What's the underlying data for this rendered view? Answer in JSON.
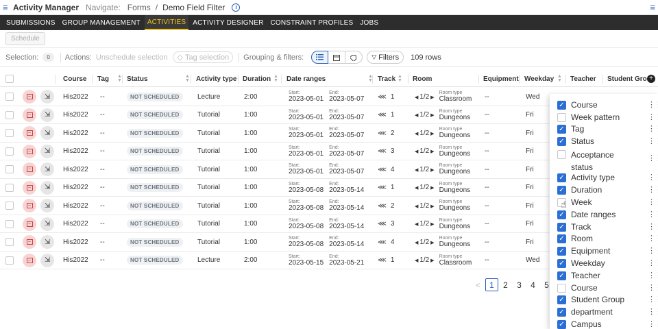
{
  "topbar": {
    "app_title": "Activity Manager",
    "navigate_label": "Navigate:",
    "crumb_1": "Forms",
    "crumb_sep": "/",
    "crumb_2": "Demo Field Filter",
    "info": "i"
  },
  "nav": {
    "tabs": [
      {
        "label": "SUBMISSIONS"
      },
      {
        "label": "GROUP MANAGEMENT"
      },
      {
        "label": "ACTIVITIES"
      },
      {
        "label": "ACTIVITY DESIGNER"
      },
      {
        "label": "CONSTRAINT PROFILES"
      },
      {
        "label": "JOBS"
      }
    ],
    "active_tab": "ACTIVITIES"
  },
  "schedule_button": "Schedule",
  "toolbar": {
    "selection_label": "Selection:",
    "selection_count": "0",
    "actions_label": "Actions:",
    "unschedule": "Unschedule selection",
    "tag_selection": "Tag selection",
    "grouping_label": "Grouping & filters:",
    "filters": "Filters",
    "rows_count": "109 rows"
  },
  "table": {
    "columns": {
      "course": "Course",
      "tag": "Tag",
      "status": "Status",
      "activity_type": "Activity type",
      "duration": "Duration",
      "date_ranges": "Date ranges",
      "track": "Track",
      "room": "Room",
      "equipment": "Equipment",
      "weekday": "Weekday",
      "teacher": "Teacher",
      "student_group": "Student Gro"
    },
    "start_label": "Start:",
    "end_label": "End:",
    "room_type_label": "Room type",
    "rows": [
      {
        "course": "His2022",
        "tag": "--",
        "status": "NOT SCHEDULED",
        "type": "Lecture",
        "duration": "2:00",
        "start": "2023-05-01",
        "end": "2023-05-07",
        "track": "1",
        "room_nav": "1/2",
        "room_type": "Classroom",
        "equipment": "--",
        "weekday": "Wed"
      },
      {
        "course": "His2022",
        "tag": "--",
        "status": "NOT SCHEDULED",
        "type": "Tutorial",
        "duration": "1:00",
        "start": "2023-05-01",
        "end": "2023-05-07",
        "track": "1",
        "room_nav": "1/2",
        "room_type": "Dungeons",
        "equipment": "--",
        "weekday": "Fri"
      },
      {
        "course": "His2022",
        "tag": "--",
        "status": "NOT SCHEDULED",
        "type": "Tutorial",
        "duration": "1:00",
        "start": "2023-05-01",
        "end": "2023-05-07",
        "track": "2",
        "room_nav": "1/2",
        "room_type": "Dungeons",
        "equipment": "--",
        "weekday": "Fri"
      },
      {
        "course": "His2022",
        "tag": "--",
        "status": "NOT SCHEDULED",
        "type": "Tutorial",
        "duration": "1:00",
        "start": "2023-05-01",
        "end": "2023-05-07",
        "track": "3",
        "room_nav": "1/2",
        "room_type": "Dungeons",
        "equipment": "--",
        "weekday": "Fri"
      },
      {
        "course": "His2022",
        "tag": "--",
        "status": "NOT SCHEDULED",
        "type": "Tutorial",
        "duration": "1:00",
        "start": "2023-05-01",
        "end": "2023-05-07",
        "track": "4",
        "room_nav": "1/2",
        "room_type": "Dungeons",
        "equipment": "--",
        "weekday": "Fri"
      },
      {
        "course": "His2022",
        "tag": "--",
        "status": "NOT SCHEDULED",
        "type": "Tutorial",
        "duration": "1:00",
        "start": "2023-05-08",
        "end": "2023-05-14",
        "track": "1",
        "room_nav": "1/2",
        "room_type": "Dungeons",
        "equipment": "--",
        "weekday": "Fri"
      },
      {
        "course": "His2022",
        "tag": "--",
        "status": "NOT SCHEDULED",
        "type": "Tutorial",
        "duration": "1:00",
        "start": "2023-05-08",
        "end": "2023-05-14",
        "track": "2",
        "room_nav": "1/2",
        "room_type": "Dungeons",
        "equipment": "--",
        "weekday": "Fri"
      },
      {
        "course": "His2022",
        "tag": "--",
        "status": "NOT SCHEDULED",
        "type": "Tutorial",
        "duration": "1:00",
        "start": "2023-05-08",
        "end": "2023-05-14",
        "track": "3",
        "room_nav": "1/2",
        "room_type": "Dungeons",
        "equipment": "--",
        "weekday": "Fri"
      },
      {
        "course": "His2022",
        "tag": "--",
        "status": "NOT SCHEDULED",
        "type": "Tutorial",
        "duration": "1:00",
        "start": "2023-05-08",
        "end": "2023-05-14",
        "track": "4",
        "room_nav": "1/2",
        "room_type": "Dungeons",
        "equipment": "--",
        "weekday": "Fri"
      },
      {
        "course": "His2022",
        "tag": "--",
        "status": "NOT SCHEDULED",
        "type": "Lecture",
        "duration": "2:00",
        "start": "2023-05-15",
        "end": "2023-05-21",
        "track": "1",
        "room_nav": "1/2",
        "room_type": "Classroom",
        "equipment": "--",
        "weekday": "Wed"
      }
    ]
  },
  "pagination": {
    "prev": "<",
    "pages": [
      "1",
      "2",
      "3",
      "4",
      "5"
    ],
    "current": "1"
  },
  "column_chooser": {
    "items": [
      {
        "label": "Course",
        "checked": true
      },
      {
        "label": "Week pattern",
        "checked": false
      },
      {
        "label": "Tag",
        "checked": true
      },
      {
        "label": "Status",
        "checked": true
      },
      {
        "label": "Acceptance status",
        "checked": false
      },
      {
        "label": "Activity type",
        "checked": true
      },
      {
        "label": "Duration",
        "checked": true
      },
      {
        "label": "Week",
        "checked": false
      },
      {
        "label": "Date ranges",
        "checked": true
      },
      {
        "label": "Track",
        "checked": true
      },
      {
        "label": "Room",
        "checked": true
      },
      {
        "label": "Equipment",
        "checked": true
      },
      {
        "label": "Weekday",
        "checked": true
      },
      {
        "label": "Teacher",
        "checked": true
      },
      {
        "label": "Course",
        "checked": false
      },
      {
        "label": "Student Group",
        "checked": true
      },
      {
        "label": "department",
        "checked": true
      },
      {
        "label": "Campus",
        "checked": true
      }
    ]
  },
  "colors": {
    "accent_blue": "#2b6fd4",
    "nav_bg": "#2d2d2d",
    "active_tab": "#f0c419",
    "unschedule_red": "#f7d4d4"
  }
}
